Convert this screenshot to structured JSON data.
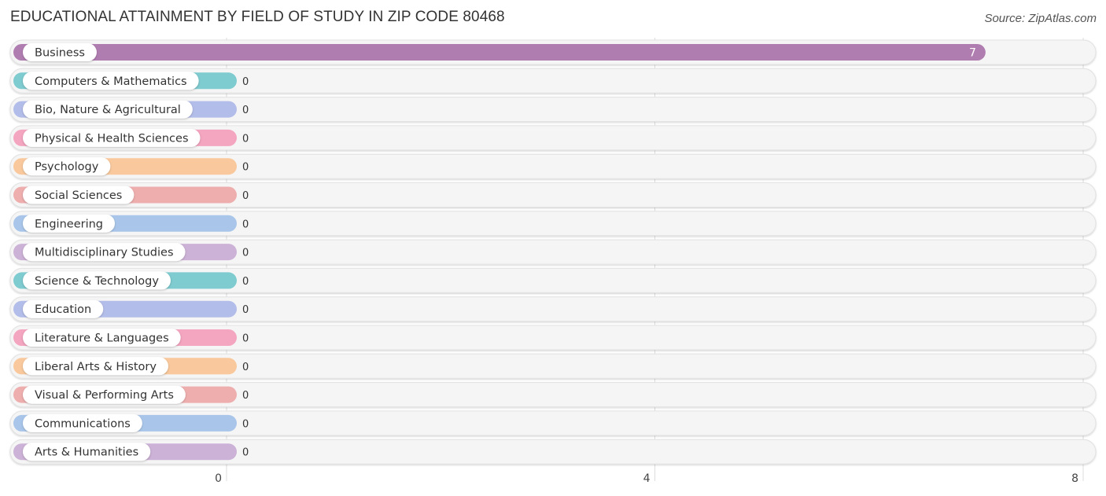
{
  "header": {
    "title": "EDUCATIONAL ATTAINMENT BY FIELD OF STUDY IN ZIP CODE 80468",
    "source": "Source: ZipAtlas.com"
  },
  "chart_data": {
    "type": "bar",
    "orientation": "horizontal",
    "title": "EDUCATIONAL ATTAINMENT BY FIELD OF STUDY IN ZIP CODE 80468",
    "xlabel": "",
    "ylabel": "",
    "xlim": [
      0,
      8
    ],
    "xticks": [
      0,
      4,
      8
    ],
    "grid": true,
    "categories": [
      "Business",
      "Computers & Mathematics",
      "Bio, Nature & Agricultural",
      "Physical & Health Sciences",
      "Psychology",
      "Social Sciences",
      "Engineering",
      "Multidisciplinary Studies",
      "Science & Technology",
      "Education",
      "Literature & Languages",
      "Liberal Arts & History",
      "Visual & Performing Arts",
      "Communications",
      "Arts & Humanities"
    ],
    "values": [
      7,
      0,
      0,
      0,
      0,
      0,
      0,
      0,
      0,
      0,
      0,
      0,
      0,
      0,
      0
    ],
    "colors": [
      "#b07db0",
      "#7ecbd0",
      "#b3bde9",
      "#f4a5bf",
      "#f9c99d",
      "#eeaeae",
      "#a9c6ea",
      "#ccb2d6",
      "#7ecbd0",
      "#b3bde9",
      "#f4a5bf",
      "#f9c99d",
      "#eeaeae",
      "#a9c6ea",
      "#ccb2d6"
    ]
  }
}
